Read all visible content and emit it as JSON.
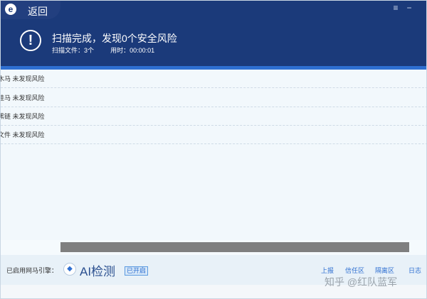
{
  "header": {
    "back_label": "返回",
    "logo_letter": "e",
    "title": "扫描完成，发现0个安全风险",
    "scan_files_label": "扫描文件：",
    "scan_files_value": "3个",
    "time_label": "用时：",
    "time_value": "00:00:01",
    "alert_icon": "exclamation-circle-icon",
    "menu_icon": "menu-icon",
    "minimize_icon": "minimize-icon",
    "colors": {
      "header_bg": "#1b3a7a",
      "accent": "#2e6fd1"
    }
  },
  "results": [
    {
      "label": "木马 未发现风险"
    },
    {
      "label": "挂马 未发现风险"
    },
    {
      "label": "黑链 未发现风险"
    },
    {
      "label": "文件 未发现风险"
    }
  ],
  "footer": {
    "engine_label": "已启用网马引擎：",
    "ai_label": "AI检测",
    "ai_status": "已开启",
    "ai_icon": "shield-ai-icon",
    "links": [
      "上报",
      "信任区",
      "隔离区",
      "日志"
    ]
  },
  "watermark": "知乎 @红队蓝军"
}
